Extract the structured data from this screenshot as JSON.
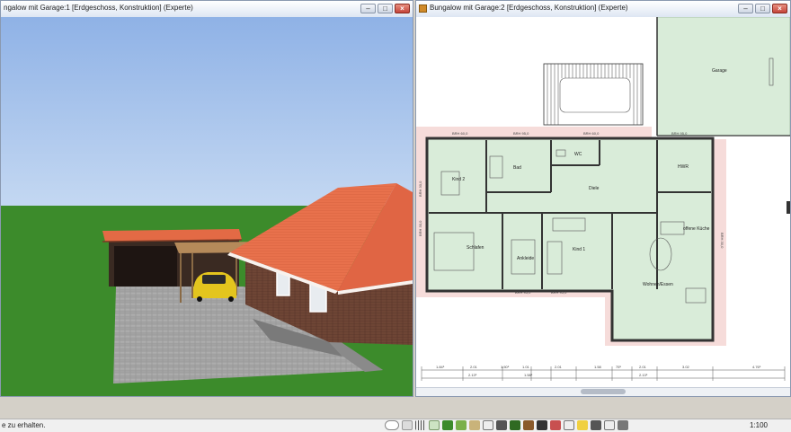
{
  "left_window": {
    "title": "ngalow mit Garage:1 [Erdgeschoss, Konstruktion] (Experte)"
  },
  "right_window": {
    "title": "Bungalow mit Garage:2 [Erdgeschoss, Konstruktion] (Experte)"
  },
  "window_controls": {
    "minimize": "–",
    "maximize": "□",
    "close": "×"
  },
  "plan": {
    "rooms": {
      "garage": "Garage",
      "kind2": "Kind 2",
      "bad": "Bad",
      "wc": "WC",
      "hwr": "HWR",
      "diele": "Diele",
      "schlafen": "Schlafen",
      "ankleide": "Ankleide",
      "kind1": "Kind 1",
      "kueche": "offene Küche",
      "wohnen": "Wohnen/Essen"
    },
    "wall_labels": {
      "brh1": "BRH 60,0",
      "brh2": "BRH 95,0",
      "brh3": "BRH 60,0",
      "brh4": "BRH 95,0",
      "brh5": "BRH 95,0",
      "brh6": "BRH 95,0",
      "brh_left": "BRH 30,0",
      "brh_left2": "BRH 30,0",
      "brh_right": "BRH 30,0"
    },
    "dims_top": [
      "1.84⁵",
      "2.01",
      "1.50⁵",
      "1.01",
      "2.01",
      "1.58",
      "75⁵",
      "2.01",
      "3.02",
      "4.76⁵"
    ],
    "dims_bottom": [
      "2.13⁵",
      "1.58⁵",
      "2.13⁵"
    ]
  },
  "statusbar": {
    "message": "e zu erhalten.",
    "scale": "1:100"
  },
  "colors": {
    "sky": "#a7c2e8",
    "grass": "#3b8c2a",
    "roof": "#e86f4a",
    "brick": "#6b4232",
    "plan_room": "#d8ecd8",
    "plan_wall": "#3a3a3a",
    "plan_outer": "#f4d2d0"
  }
}
